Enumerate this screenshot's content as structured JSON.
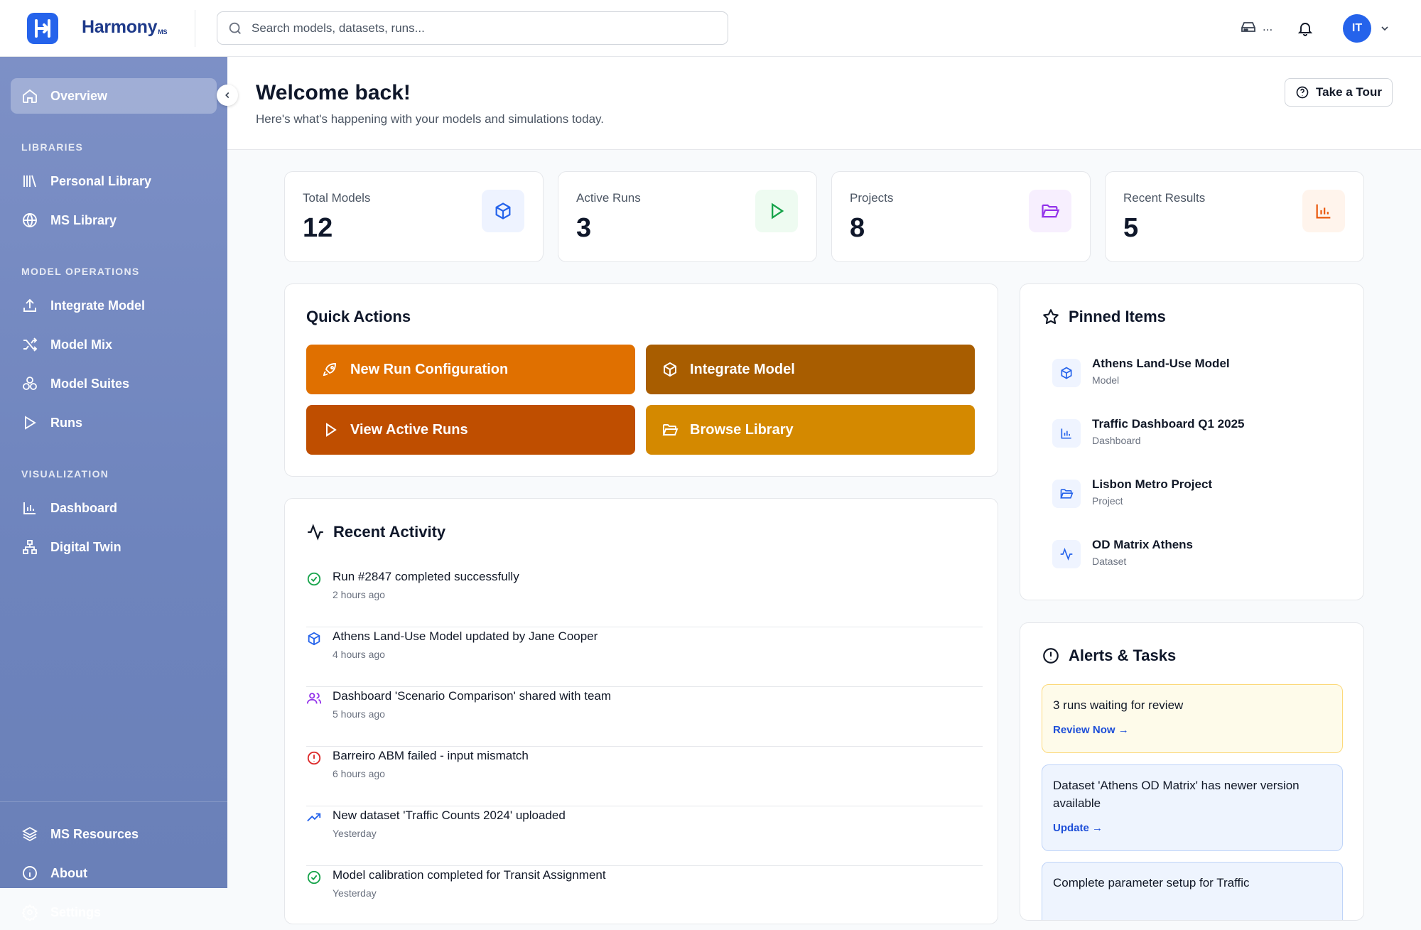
{
  "app": {
    "brand": "Harmony",
    "brand_suffix": "MS",
    "avatar_initials": "IT",
    "workspace_label": "..."
  },
  "search": {
    "placeholder": "Search models, datasets, runs..."
  },
  "sidebar": {
    "top": [
      {
        "label": "Overview",
        "icon": "home-icon"
      }
    ],
    "sections": [
      {
        "title": "LIBRARIES",
        "items": [
          {
            "label": "Personal Library",
            "icon": "library-icon"
          },
          {
            "label": "MS Library",
            "icon": "globe-icon"
          }
        ]
      },
      {
        "title": "MODEL OPERATIONS",
        "items": [
          {
            "label": "Integrate Model",
            "icon": "upload-icon"
          },
          {
            "label": "Model Mix",
            "icon": "shuffle-icon"
          },
          {
            "label": "Model Suites",
            "icon": "boxes-icon"
          },
          {
            "label": "Runs",
            "icon": "play-icon"
          }
        ]
      },
      {
        "title": "VISUALIZATION",
        "items": [
          {
            "label": "Dashboard",
            "icon": "bar-chart-icon"
          },
          {
            "label": "Digital Twin",
            "icon": "network-icon"
          }
        ]
      }
    ],
    "bottom": [
      {
        "label": "MS Resources",
        "icon": "layers-icon"
      },
      {
        "label": "About",
        "icon": "info-icon"
      },
      {
        "label": "Settings",
        "icon": "gear-icon"
      }
    ]
  },
  "header": {
    "title": "Welcome back!",
    "subtitle": "Here's what's happening with your models and simulations today.",
    "tour_label": "Take a Tour"
  },
  "stats": [
    {
      "label": "Total Models",
      "value": "12",
      "icon": "cube-icon",
      "color": "#2563eb"
    },
    {
      "label": "Active Runs",
      "value": "3",
      "icon": "play-icon",
      "color": "#16a34a"
    },
    {
      "label": "Projects",
      "value": "8",
      "icon": "folder-icon",
      "color": "#9333ea"
    },
    {
      "label": "Recent Results",
      "value": "5",
      "icon": "bar-chart-icon",
      "color": "#ea580c"
    }
  ],
  "quick_actions": {
    "title": "Quick Actions",
    "items": [
      {
        "label": "New Run Configuration",
        "icon": "rocket-icon",
        "color": "#e07000"
      },
      {
        "label": "Integrate Model",
        "icon": "cube-icon",
        "color": "#a85d00"
      },
      {
        "label": "View Active Runs",
        "icon": "play-icon",
        "color": "#bf4e00"
      },
      {
        "label": "Browse Library",
        "icon": "folder-icon",
        "color": "#d48900"
      }
    ]
  },
  "activity": {
    "title": "Recent Activity",
    "items": [
      {
        "text": "Run #2847 completed successfully",
        "time": "2 hours ago",
        "icon": "check-circle-icon"
      },
      {
        "text": "Athens Land-Use Model updated by Jane Cooper",
        "time": "4 hours ago",
        "icon": "cube-icon"
      },
      {
        "text": "Dashboard 'Scenario Comparison' shared with team",
        "time": "5 hours ago",
        "icon": "users-icon"
      },
      {
        "text": "Barreiro ABM failed - input mismatch",
        "time": "6 hours ago",
        "icon": "alert-circle-icon"
      },
      {
        "text": "New dataset 'Traffic Counts 2024' uploaded",
        "time": "Yesterday",
        "icon": "trending-up-icon"
      },
      {
        "text": "Model calibration completed for Transit Assignment",
        "time": "Yesterday",
        "icon": "check-circle-icon"
      }
    ]
  },
  "pinned": {
    "title": "Pinned Items",
    "items": [
      {
        "name": "Athens Land-Use Model",
        "type": "Model",
        "icon": "cube-icon"
      },
      {
        "name": "Traffic Dashboard Q1 2025",
        "type": "Dashboard",
        "icon": "bar-chart-icon"
      },
      {
        "name": "Lisbon Metro Project",
        "type": "Project",
        "icon": "folder-icon"
      },
      {
        "name": "OD Matrix Athens",
        "type": "Dataset",
        "icon": "activity-icon"
      }
    ]
  },
  "alerts": {
    "title": "Alerts & Tasks",
    "items": [
      {
        "text": "3 runs waiting for review",
        "link": "Review Now →"
      },
      {
        "text": "Dataset 'Athens OD Matrix' has newer version available",
        "link": "Update →"
      },
      {
        "text": "Complete parameter setup for Traffic"
      }
    ]
  }
}
